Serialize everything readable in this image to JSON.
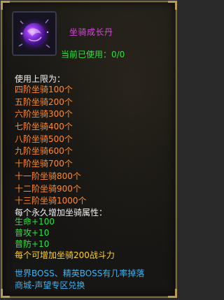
{
  "item": {
    "icon": "mount-growth-pill-icon",
    "name": "坐骑成长丹",
    "owned_text": "当前已使用：0/0"
  },
  "limits": {
    "title": "使用上限为：",
    "items": [
      "四阶坐骑100个",
      "五阶坐骑200个",
      "六阶坐骑300个",
      "七阶坐骑400个",
      "八阶坐骑500个",
      "九阶坐骑600个",
      "十阶坐骑700个",
      "十一阶坐骑800个",
      "十二阶坐骑900个",
      "十三阶坐骑1000个"
    ]
  },
  "attributes": {
    "title": "每个永久增加坐骑属性：",
    "items": [
      "生命+100",
      "普攻+10",
      "普防+10",
      "每个可增加坐骑200战斗力"
    ]
  },
  "sources": [
    "世界BOSS、精英BOSS有几率掉落",
    "商城-声望专区兑换"
  ],
  "colors": {
    "name": "#e040e8",
    "owned": "#26e63a",
    "limit_items": "#ff8a2a",
    "attr_green": "#26e63a",
    "attr_yellow": "#ffd21e",
    "sources": "#3cb4f2",
    "border": "#7a6a3e"
  }
}
